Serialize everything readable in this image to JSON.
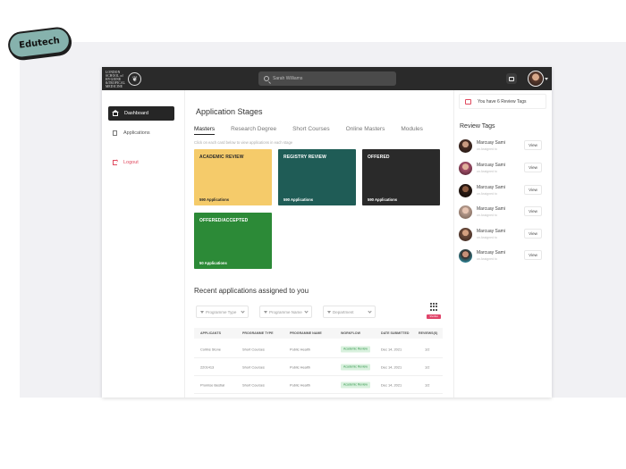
{
  "overlay_badge": "Edutech",
  "topbar": {
    "logo_lines": [
      "LONDON",
      "SCHOOL of",
      "HYGIENE",
      "&TROPICAL",
      "MEDICINE"
    ],
    "search_placeholder": "Sarah Williams",
    "icons": [
      "search-icon",
      "chat-icon"
    ]
  },
  "sidebar": {
    "items": [
      {
        "label": "Dashboard",
        "icon": "home-icon",
        "active": true
      },
      {
        "label": "Applications",
        "icon": "document-icon",
        "active": false
      }
    ],
    "logout_label": "Logout"
  },
  "main": {
    "title": "Application Stages",
    "tabs": [
      "Masters",
      "Research Degree",
      "Short Courses",
      "Online Masters",
      "Modules"
    ],
    "active_tab": "Masters",
    "hint": "Click on each card below to view applications in each stage",
    "stages": [
      {
        "title": "ACADEMIC REVIEW",
        "count": "590 Applications",
        "bg": "#f5cb6a",
        "fg": "#2a2a2a"
      },
      {
        "title": "REGISTRY REVIEW",
        "count": "590 Applications",
        "bg": "#1f5c56",
        "fg": "#ffffff"
      },
      {
        "title": "OFFERED",
        "count": "590 Applications",
        "bg": "#2a2a2a",
        "fg": "#ffffff"
      },
      {
        "title": "OFFERED/ACCEPTED",
        "count": "50 Applications",
        "bg": "#2c8a37",
        "fg": "#ffffff"
      }
    ],
    "recent_title": "Recent applications assigned to you",
    "export_label": "Shortlist",
    "filters": [
      "Programme Type",
      "Programme Name",
      "Department"
    ],
    "table": {
      "headers": [
        "APPLICANTS",
        "PROGRAMME TYPE",
        "PROGRAMME NAME",
        "WORKFLOW",
        "DATE SUBMITTED",
        "REVIEWS(S)"
      ],
      "rows": [
        [
          "Collins Stone",
          "Short Courses",
          "Public Health",
          "Academic Review",
          "Dec 14, 2021",
          "1/2"
        ],
        [
          "2201413",
          "Short Courses",
          "Public Health",
          "Academic Review",
          "Dec 14, 2021",
          "1/2"
        ],
        [
          "Promise Bestial",
          "Short Courses",
          "Public Health",
          "Academic Review",
          "Dec 14, 2021",
          "1/2"
        ]
      ]
    }
  },
  "rightpanel": {
    "notice": "You have 6 Review Tags",
    "title": "Review Tags",
    "items": [
      {
        "name": "Marcuay Sami",
        "sub": "on Assigned to",
        "action": "View"
      },
      {
        "name": "Marcuay Sami",
        "sub": "on Assigned to",
        "action": "View"
      },
      {
        "name": "Marcuay Sami",
        "sub": "on Assigned to",
        "action": "View"
      },
      {
        "name": "Marcuay Sami",
        "sub": "on Assigned to",
        "action": "View"
      },
      {
        "name": "Marcuay Sami",
        "sub": "on Assigned to",
        "action": "View"
      },
      {
        "name": "Marcuay Sami",
        "sub": "on Assigned to",
        "action": "View"
      }
    ]
  },
  "colors": {
    "accent_red": "#e04a5f",
    "workflow_green": "#3c9b53",
    "topbar": "#2a2a2a"
  }
}
